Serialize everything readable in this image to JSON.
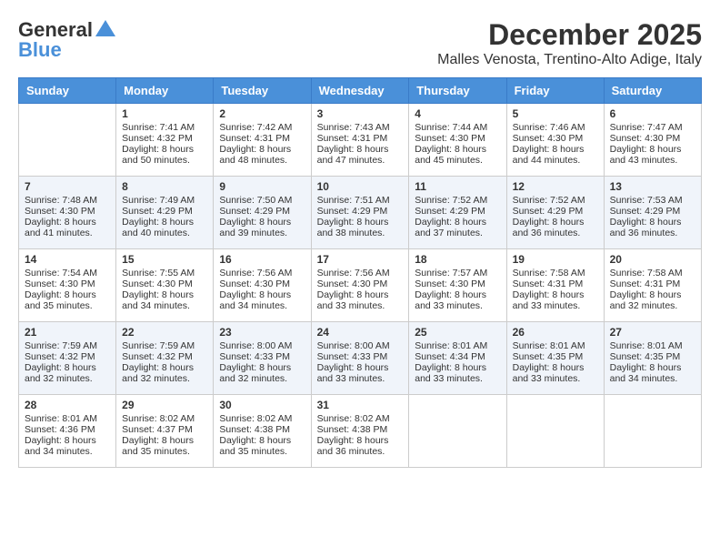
{
  "header": {
    "logo_line1": "General",
    "logo_line2": "Blue",
    "month": "December 2025",
    "location": "Malles Venosta, Trentino-Alto Adige, Italy"
  },
  "weekdays": [
    "Sunday",
    "Monday",
    "Tuesday",
    "Wednesday",
    "Thursday",
    "Friday",
    "Saturday"
  ],
  "weeks": [
    [
      {
        "day": "",
        "sunrise": "",
        "sunset": "",
        "daylight": ""
      },
      {
        "day": "1",
        "sunrise": "Sunrise: 7:41 AM",
        "sunset": "Sunset: 4:32 PM",
        "daylight": "Daylight: 8 hours and 50 minutes."
      },
      {
        "day": "2",
        "sunrise": "Sunrise: 7:42 AM",
        "sunset": "Sunset: 4:31 PM",
        "daylight": "Daylight: 8 hours and 48 minutes."
      },
      {
        "day": "3",
        "sunrise": "Sunrise: 7:43 AM",
        "sunset": "Sunset: 4:31 PM",
        "daylight": "Daylight: 8 hours and 47 minutes."
      },
      {
        "day": "4",
        "sunrise": "Sunrise: 7:44 AM",
        "sunset": "Sunset: 4:30 PM",
        "daylight": "Daylight: 8 hours and 45 minutes."
      },
      {
        "day": "5",
        "sunrise": "Sunrise: 7:46 AM",
        "sunset": "Sunset: 4:30 PM",
        "daylight": "Daylight: 8 hours and 44 minutes."
      },
      {
        "day": "6",
        "sunrise": "Sunrise: 7:47 AM",
        "sunset": "Sunset: 4:30 PM",
        "daylight": "Daylight: 8 hours and 43 minutes."
      }
    ],
    [
      {
        "day": "7",
        "sunrise": "Sunrise: 7:48 AM",
        "sunset": "Sunset: 4:30 PM",
        "daylight": "Daylight: 8 hours and 41 minutes."
      },
      {
        "day": "8",
        "sunrise": "Sunrise: 7:49 AM",
        "sunset": "Sunset: 4:29 PM",
        "daylight": "Daylight: 8 hours and 40 minutes."
      },
      {
        "day": "9",
        "sunrise": "Sunrise: 7:50 AM",
        "sunset": "Sunset: 4:29 PM",
        "daylight": "Daylight: 8 hours and 39 minutes."
      },
      {
        "day": "10",
        "sunrise": "Sunrise: 7:51 AM",
        "sunset": "Sunset: 4:29 PM",
        "daylight": "Daylight: 8 hours and 38 minutes."
      },
      {
        "day": "11",
        "sunrise": "Sunrise: 7:52 AM",
        "sunset": "Sunset: 4:29 PM",
        "daylight": "Daylight: 8 hours and 37 minutes."
      },
      {
        "day": "12",
        "sunrise": "Sunrise: 7:52 AM",
        "sunset": "Sunset: 4:29 PM",
        "daylight": "Daylight: 8 hours and 36 minutes."
      },
      {
        "day": "13",
        "sunrise": "Sunrise: 7:53 AM",
        "sunset": "Sunset: 4:29 PM",
        "daylight": "Daylight: 8 hours and 36 minutes."
      }
    ],
    [
      {
        "day": "14",
        "sunrise": "Sunrise: 7:54 AM",
        "sunset": "Sunset: 4:30 PM",
        "daylight": "Daylight: 8 hours and 35 minutes."
      },
      {
        "day": "15",
        "sunrise": "Sunrise: 7:55 AM",
        "sunset": "Sunset: 4:30 PM",
        "daylight": "Daylight: 8 hours and 34 minutes."
      },
      {
        "day": "16",
        "sunrise": "Sunrise: 7:56 AM",
        "sunset": "Sunset: 4:30 PM",
        "daylight": "Daylight: 8 hours and 34 minutes."
      },
      {
        "day": "17",
        "sunrise": "Sunrise: 7:56 AM",
        "sunset": "Sunset: 4:30 PM",
        "daylight": "Daylight: 8 hours and 33 minutes."
      },
      {
        "day": "18",
        "sunrise": "Sunrise: 7:57 AM",
        "sunset": "Sunset: 4:30 PM",
        "daylight": "Daylight: 8 hours and 33 minutes."
      },
      {
        "day": "19",
        "sunrise": "Sunrise: 7:58 AM",
        "sunset": "Sunset: 4:31 PM",
        "daylight": "Daylight: 8 hours and 33 minutes."
      },
      {
        "day": "20",
        "sunrise": "Sunrise: 7:58 AM",
        "sunset": "Sunset: 4:31 PM",
        "daylight": "Daylight: 8 hours and 32 minutes."
      }
    ],
    [
      {
        "day": "21",
        "sunrise": "Sunrise: 7:59 AM",
        "sunset": "Sunset: 4:32 PM",
        "daylight": "Daylight: 8 hours and 32 minutes."
      },
      {
        "day": "22",
        "sunrise": "Sunrise: 7:59 AM",
        "sunset": "Sunset: 4:32 PM",
        "daylight": "Daylight: 8 hours and 32 minutes."
      },
      {
        "day": "23",
        "sunrise": "Sunrise: 8:00 AM",
        "sunset": "Sunset: 4:33 PM",
        "daylight": "Daylight: 8 hours and 32 minutes."
      },
      {
        "day": "24",
        "sunrise": "Sunrise: 8:00 AM",
        "sunset": "Sunset: 4:33 PM",
        "daylight": "Daylight: 8 hours and 33 minutes."
      },
      {
        "day": "25",
        "sunrise": "Sunrise: 8:01 AM",
        "sunset": "Sunset: 4:34 PM",
        "daylight": "Daylight: 8 hours and 33 minutes."
      },
      {
        "day": "26",
        "sunrise": "Sunrise: 8:01 AM",
        "sunset": "Sunset: 4:35 PM",
        "daylight": "Daylight: 8 hours and 33 minutes."
      },
      {
        "day": "27",
        "sunrise": "Sunrise: 8:01 AM",
        "sunset": "Sunset: 4:35 PM",
        "daylight": "Daylight: 8 hours and 34 minutes."
      }
    ],
    [
      {
        "day": "28",
        "sunrise": "Sunrise: 8:01 AM",
        "sunset": "Sunset: 4:36 PM",
        "daylight": "Daylight: 8 hours and 34 minutes."
      },
      {
        "day": "29",
        "sunrise": "Sunrise: 8:02 AM",
        "sunset": "Sunset: 4:37 PM",
        "daylight": "Daylight: 8 hours and 35 minutes."
      },
      {
        "day": "30",
        "sunrise": "Sunrise: 8:02 AM",
        "sunset": "Sunset: 4:38 PM",
        "daylight": "Daylight: 8 hours and 35 minutes."
      },
      {
        "day": "31",
        "sunrise": "Sunrise: 8:02 AM",
        "sunset": "Sunset: 4:38 PM",
        "daylight": "Daylight: 8 hours and 36 minutes."
      },
      {
        "day": "",
        "sunrise": "",
        "sunset": "",
        "daylight": ""
      },
      {
        "day": "",
        "sunrise": "",
        "sunset": "",
        "daylight": ""
      },
      {
        "day": "",
        "sunrise": "",
        "sunset": "",
        "daylight": ""
      }
    ]
  ]
}
